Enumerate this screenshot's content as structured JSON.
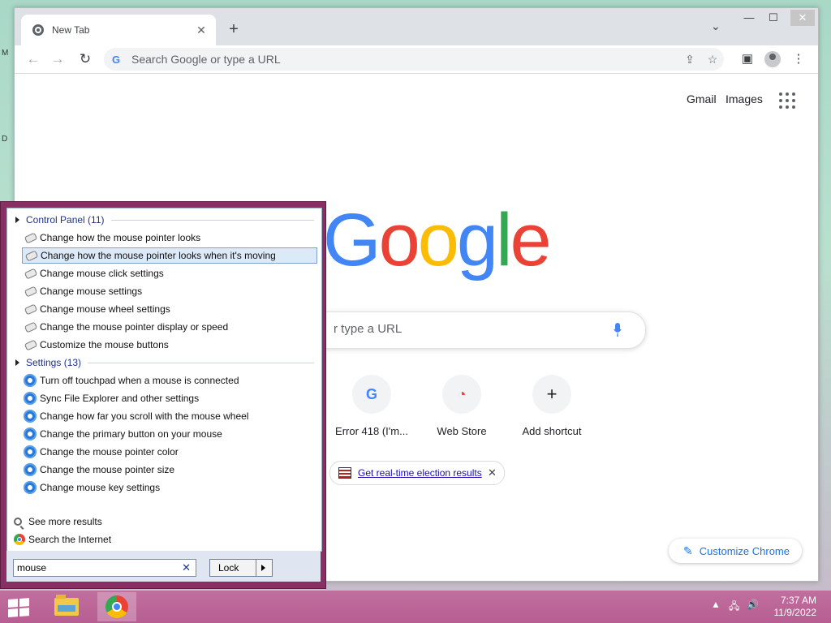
{
  "desktop": {
    "marks": [
      "M",
      "D"
    ]
  },
  "browser": {
    "tab_title": "New Tab",
    "tab_close": "✕",
    "new_tab": "+",
    "tab_menu": "⌄",
    "omnibox_placeholder": "Search Google or type a URL",
    "omnibox_g": "G",
    "window": {
      "minimize": "—",
      "maximize": "☐",
      "close": "✕"
    }
  },
  "ntp": {
    "links": [
      "Gmail",
      "Images"
    ],
    "logo_letters": [
      {
        "ch": "G",
        "color": "#4285f4"
      },
      {
        "ch": "o",
        "color": "#ea4335"
      },
      {
        "ch": "o",
        "color": "#fbbc05"
      },
      {
        "ch": "g",
        "color": "#4285f4"
      },
      {
        "ch": "l",
        "color": "#34a853"
      },
      {
        "ch": "e",
        "color": "#ea4335"
      }
    ],
    "search_placeholder": "r type a URL",
    "shortcuts": [
      {
        "label": "Error 418 (I'm...",
        "icon": "G"
      },
      {
        "label": "Web Store",
        "icon": "◔"
      },
      {
        "label": "Add shortcut",
        "icon": "+"
      }
    ],
    "promo_link": "Get real-time election results",
    "promo_close": "✕",
    "customize_label": "Customize Chrome",
    "customize_icon": "✎"
  },
  "start_menu": {
    "groups": [
      {
        "label": "Control Panel (11)",
        "items": [
          "Change how the mouse pointer looks",
          "Change how the mouse pointer looks when it's moving",
          "Change mouse click settings",
          "Change mouse settings",
          "Change mouse wheel settings",
          "Change the mouse pointer display or speed",
          "Customize the mouse buttons"
        ],
        "selected_index": 1
      },
      {
        "label": "Settings (13)",
        "items": [
          "Turn off touchpad when a mouse is connected",
          "Sync File Explorer and other settings",
          "Change how far you scroll with the mouse wheel",
          "Change the primary button on your mouse",
          "Change the mouse pointer color",
          "Change the mouse pointer size",
          "Change mouse key settings"
        ]
      }
    ],
    "see_more": "See more results",
    "search_internet": "Search the Internet",
    "search_value": "mouse",
    "clear_icon": "✕",
    "power_label": "Lock"
  },
  "taskbar": {
    "time": "7:37 AM",
    "date": "11/9/2022",
    "tray_chevron": "▲",
    "tray_network": "🖧",
    "tray_volume": "🔊"
  }
}
